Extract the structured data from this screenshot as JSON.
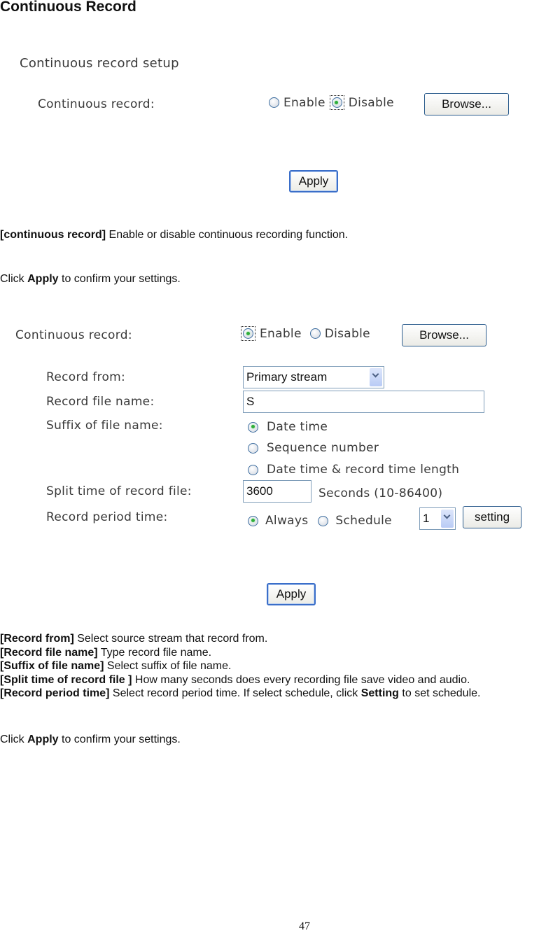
{
  "page": {
    "title": "Continuous Record",
    "page_number": "47"
  },
  "screenshot1": {
    "section_title": "Continuous record setup",
    "continuous_record_label": "Continuous record:",
    "enable_label": "Enable",
    "disable_label": "Disable",
    "selected": "Disable",
    "browse_button": "Browse...",
    "apply_button": "Apply"
  },
  "desc1": {
    "term": "[continuous record]",
    "text": " Enable or disable continuous recording function."
  },
  "click1": {
    "prefix": "Click ",
    "bold": "Apply",
    "suffix": " to confirm your settings."
  },
  "screenshot2": {
    "continuous_record_label": "Continuous record:",
    "enable_label": "Enable",
    "disable_label": "Disable",
    "selected": "Enable",
    "browse_button": "Browse...",
    "record_from_label": "Record from:",
    "record_from_value": "Primary stream",
    "record_file_name_label": "Record file name:",
    "record_file_name_value": "S",
    "suffix_label": "Suffix of file name:",
    "suffix_options": [
      "Date time",
      "Sequence number",
      "Date time & record time length"
    ],
    "suffix_selected": "Date time",
    "split_time_label": "Split time of record file:",
    "split_time_value": "3600",
    "split_time_unit": "Seconds (10-86400)",
    "period_label": "Record period time:",
    "period_always": "Always",
    "period_schedule": "Schedule",
    "period_selected": "Always",
    "schedule_value": "1",
    "setting_button": "setting",
    "apply_button": "Apply"
  },
  "desc2": [
    {
      "term": "[Record from]",
      "text": " Select source stream that record from."
    },
    {
      "term": "[Record file name]",
      "text": " Type record file name."
    },
    {
      "term": "[Suffix of file name]",
      "text": " Select suffix of file name."
    },
    {
      "term": "[Split time of record file ]",
      "text": " How many seconds does every recording file save video and audio."
    },
    {
      "term": "[Record period time]",
      "text": " Select record period time. If select schedule, click ",
      "bold2": "Setting",
      "text2": " to set schedule."
    }
  ],
  "click2": {
    "prefix": "Click ",
    "bold": "Apply",
    "suffix": " to confirm your settings."
  }
}
